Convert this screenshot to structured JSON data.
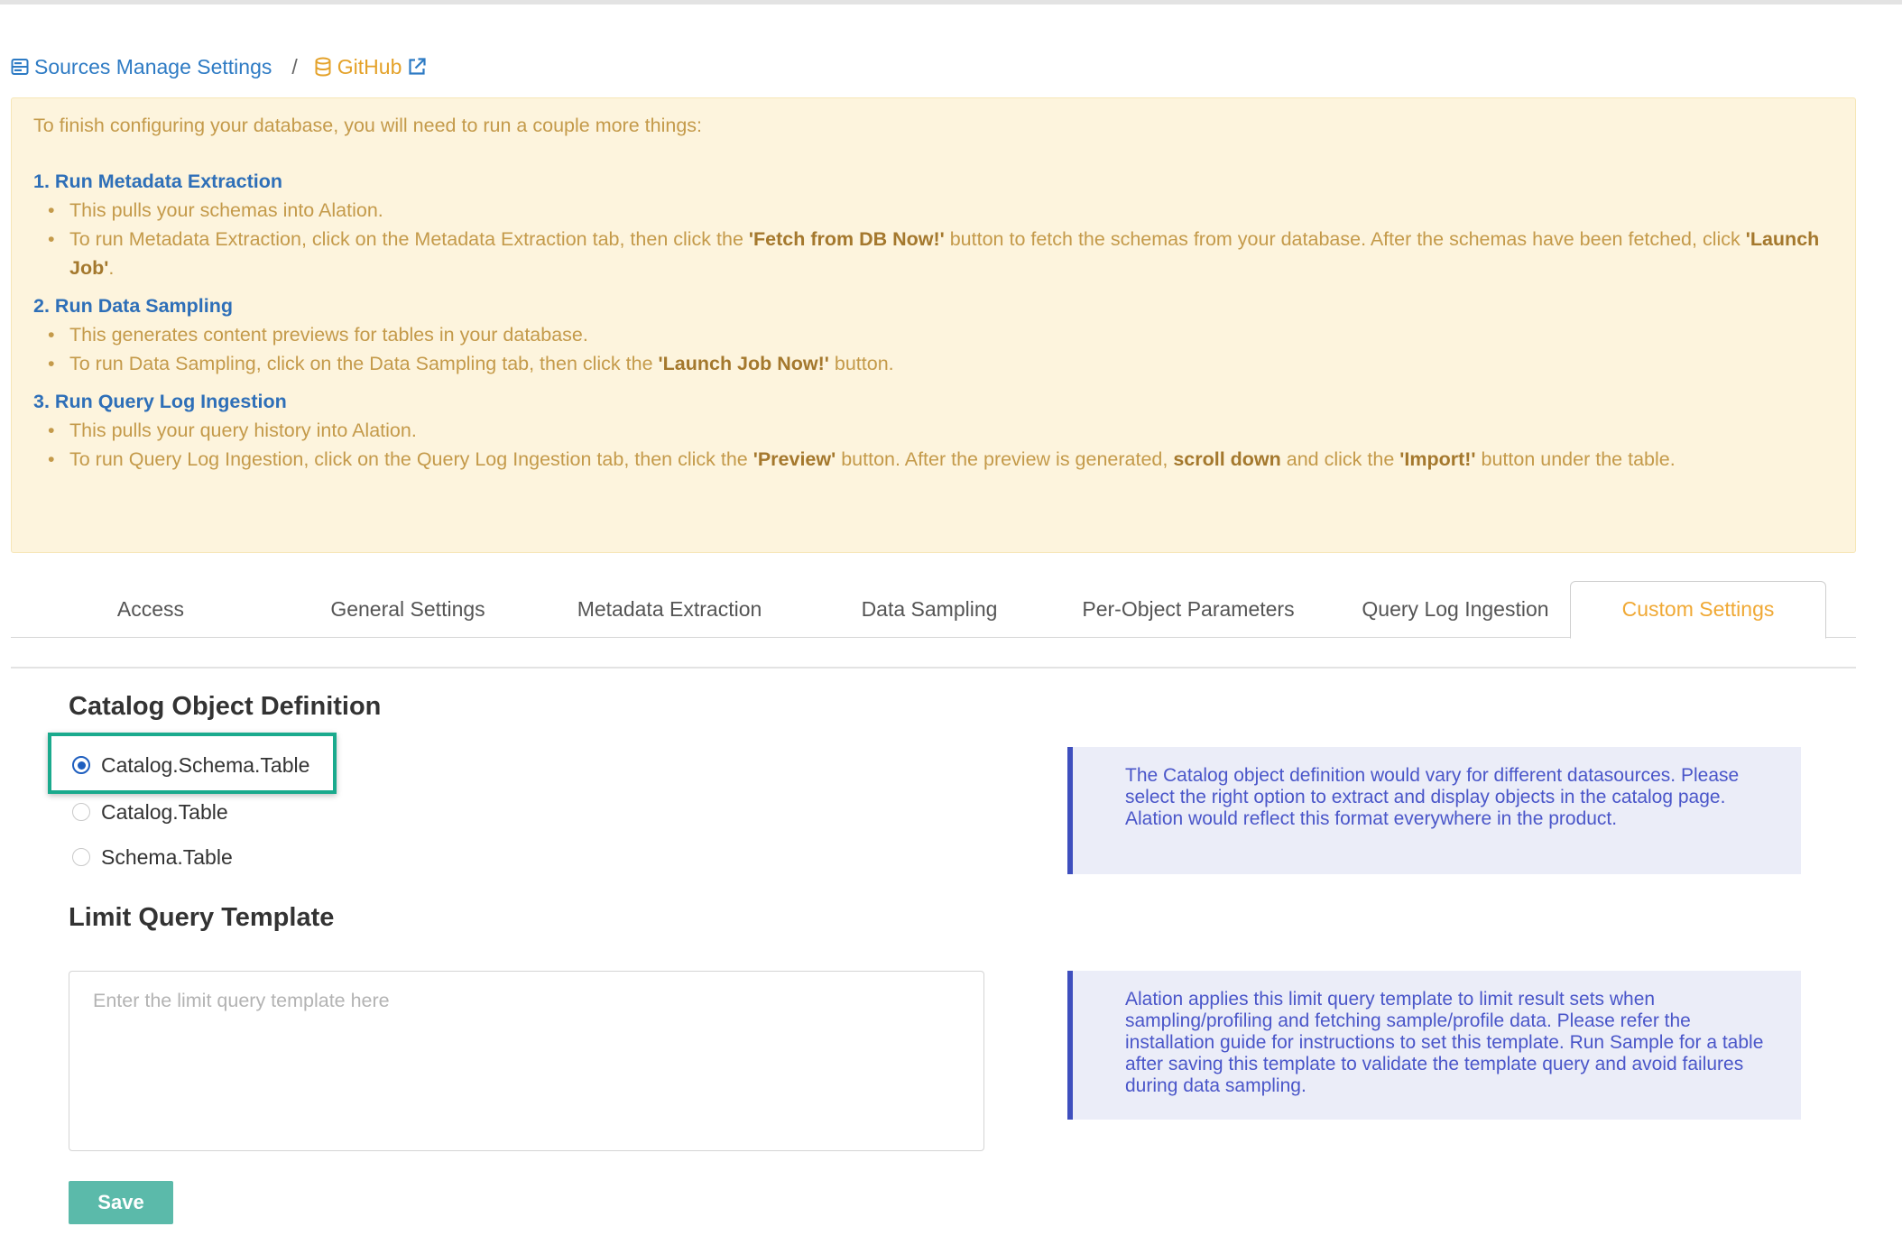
{
  "breadcrumb": {
    "parent_label": "Sources Manage Settings",
    "separator": "/",
    "current_label": "GitHub"
  },
  "alert": {
    "intro": "To finish configuring your database, you will need to run a couple more things:",
    "steps": [
      {
        "number": "1.",
        "title": "Run Metadata Extraction",
        "bullets": [
          {
            "text": "This pulls your schemas into Alation."
          },
          {
            "parts": [
              "To run Metadata Extraction, click on the Metadata Extraction tab, then click the ",
              "'Fetch from DB Now!'",
              " button to fetch the schemas from your database. After the schemas have been fetched, click ",
              "'Launch Job'",
              "."
            ]
          }
        ]
      },
      {
        "number": "2.",
        "title": "Run Data Sampling",
        "bullets": [
          {
            "text": "This generates content previews for tables in your database."
          },
          {
            "parts": [
              "To run Data Sampling, click on the Data Sampling tab, then click the ",
              "'Launch Job Now!'",
              " button."
            ]
          }
        ]
      },
      {
        "number": "3.",
        "title": "Run Query Log Ingestion",
        "bullets": [
          {
            "text": "This pulls your query history into Alation."
          },
          {
            "parts": [
              "To run Query Log Ingestion, click on the Query Log Ingestion tab, then click the ",
              "'Preview'",
              " button. After the preview is generated, ",
              "scroll down",
              " and click the ",
              "'Import!'",
              " button under the table."
            ]
          }
        ]
      }
    ]
  },
  "tabs": [
    {
      "label": "Access",
      "active": false
    },
    {
      "label": "General Settings",
      "active": false
    },
    {
      "label": "Metadata Extraction",
      "active": false
    },
    {
      "label": "Data Sampling",
      "active": false
    },
    {
      "label": "Per-Object Parameters",
      "active": false
    },
    {
      "label": "Query Log Ingestion",
      "active": false
    },
    {
      "label": "Custom Settings",
      "active": true
    }
  ],
  "catalog_section": {
    "title": "Catalog Object Definition",
    "options": [
      {
        "label": "Catalog.Schema.Table",
        "selected": true
      },
      {
        "label": "Catalog.Table",
        "selected": false
      },
      {
        "label": "Schema.Table",
        "selected": false
      }
    ],
    "info": "The Catalog object definition would vary for different datasources. Please select the right option to extract and display objects in the catalog page. Alation would reflect this format everywhere in the product."
  },
  "limit_section": {
    "title": "Limit Query Template",
    "input_value": "",
    "input_placeholder": "Enter the limit query template here",
    "info": "Alation applies this limit query template to limit result sets when sampling/profiling and fetching sample/profile data. Please refer the installation guide for instructions to set this template. Run Sample for a table after saving this template to validate the template query and avoid failures during data sampling."
  },
  "save_label": "Save",
  "colors": {
    "link": "#2e7bc4",
    "active_tab": "#f0a935",
    "alert_bg": "#fdf4dd",
    "highlight_border": "#1aaa8d",
    "info_bg": "#ebedf8",
    "info_border": "#3e4fbe",
    "save_bg": "#5bbaaa"
  }
}
